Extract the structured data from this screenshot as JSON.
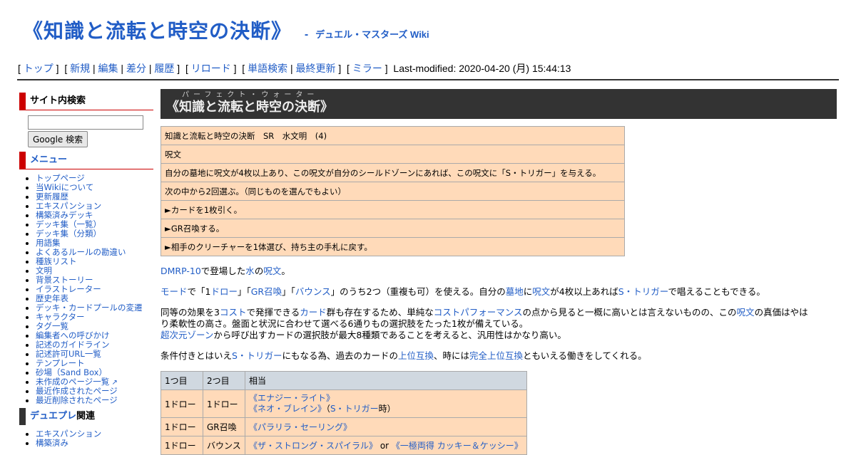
{
  "header": {
    "title": "《知識と流転と時空の決断》",
    "separator": "-",
    "site_name": "デュエル・マスターズ Wiki"
  },
  "navbar": {
    "top": "トップ",
    "new": "新規",
    "edit": "編集",
    "diff": "差分",
    "history": "履歴",
    "reload": "リロード",
    "word_search": "単語検索",
    "recent": "最終更新",
    "mirror": "ミラー",
    "last_modified": "Last-modified: 2020-04-20 (月) 15:44:13"
  },
  "sidebar": {
    "search_heading": "サイト内検索",
    "search_button": "Google 検索",
    "menu_heading": "メニュー",
    "menu_items": [
      "トップページ",
      "当Wikiについて",
      "更新履歴",
      "エキスパンション",
      "構築済みデッキ",
      "デッキ集（一覧）",
      "デッキ集（分類）",
      "用語集",
      "よくあるルールの勘違い",
      "種族リスト",
      "文明",
      "背景ストーリー",
      "イラストレーター",
      "歴史年表",
      "デッキ・カードプールの変遷",
      "キャラクター",
      "タグ一覧",
      "編集者への呼びかけ",
      "記述のガイドライン",
      "記述許可URL一覧",
      "テンプレート",
      "砂場（Sand Box）",
      "未作成のページ一覧",
      "最近作成されたページ",
      "最近削除されたページ"
    ],
    "ext_icon": "external-link-icon",
    "duepre_link": "デュエプレ",
    "duepre_suffix": "関連",
    "duepre_items": [
      "エキスパンション",
      "構築済み"
    ]
  },
  "page": {
    "ruby": "パーフェクト・ウォーター",
    "title": "《知識と流転と時空の決断》",
    "card": {
      "r1": "知識と流転と時空の決断　SR　水文明　(4)",
      "r2": "呪文",
      "r3": "自分の墓地に呪文が4枚以上あり、この呪文が自分のシールドゾーンにあれば、この呪文に「S・トリガー」を与える。",
      "r4": "次の中から2回選ぶ。（同じものを選んでもよい）",
      "r5": "►カードを1枚引く。",
      "r6": "►GR召喚する。",
      "r7": "►相手のクリーチャーを1体選び、持ち主の手札に戻す。"
    },
    "p1": {
      "a": "DMRP-10",
      "b": "で登場した",
      "c": "水",
      "d": "の",
      "e": "呪文",
      "f": "。"
    },
    "p2": {
      "a": "モード",
      "b": "で「1",
      "c": "ドロー",
      "d": "」「",
      "e": "GR召喚",
      "f": "」「",
      "g": "バウンス",
      "h": "」のうち2つ（重複も可）を使える。自分の",
      "i": "墓地",
      "j": "に",
      "k": "呪文",
      "l": "が4枚以上あれば",
      "m": "S・トリガー",
      "n": "で唱えることもできる。"
    },
    "p3": {
      "a": "同等の効果を3",
      "b": "コスト",
      "c": "で発揮できる",
      "d": "カード",
      "e": "群も存在するため、単純な",
      "f": "コストパフォーマンス",
      "g": "の点から見ると一概に高いとは言えないものの、この",
      "h": "呪文",
      "i": "の真価はやは",
      "j": "り柔軟性の高さ。盤面と状況に合わせて選べる6通りもの選択肢をたった1枚が備えている。",
      "k": "超次元ゾーン",
      "l": "から呼び出すカードの選択肢が最大8種類であることを考えると、汎用性はかなり高い。"
    },
    "p4": {
      "a": "条件付きとはいえ",
      "b": "S・トリガー",
      "c": "にもなる為、過去のカードの",
      "d": "上位互換",
      "e": "、時には",
      "f": "完全上位互換",
      "g": "ともいえる働きをしてくれる。"
    },
    "table": {
      "headers": [
        "1つ目",
        "2つ目",
        "相当"
      ],
      "rows": [
        {
          "c1": "1ドロー",
          "c2": "1ドロー",
          "l1": "《エナジー・ライト》",
          "l2": "《ネオ・ブレイン》",
          "l2_suffix_a": "（",
          "l2_link": "S・トリガー",
          "l2_suffix_b": "時）"
        },
        {
          "c1": "1ドロー",
          "c2": "GR召喚",
          "l1": "《パラリラ・セーリング》"
        },
        {
          "c1": "1ドロー",
          "c2": "バウンス",
          "l1": "《ザ・ストロング・スパイラル》",
          "or": " or ",
          "l1b": "《一極両得 カッキー＆ケッシー》"
        }
      ]
    }
  }
}
